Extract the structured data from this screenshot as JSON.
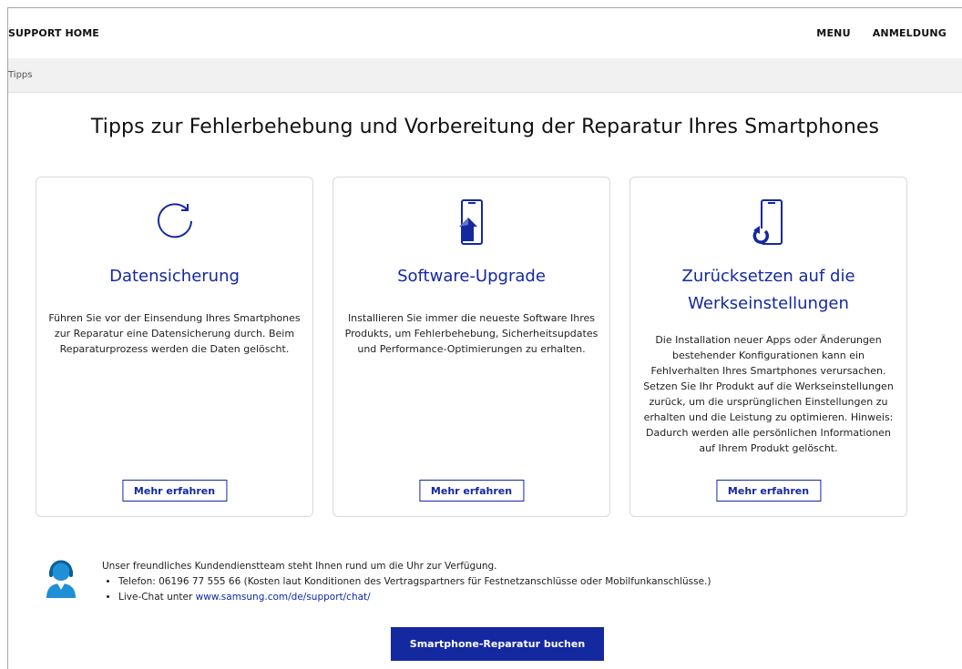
{
  "header": {
    "brand": "SUPPORT HOME",
    "menu": "MENU",
    "login": "ANMELDUNG"
  },
  "breadcrumb": "Tipps",
  "page_title": "Tipps zur Fehlerbehebung und Vorbereitung der Reparatur Ihres Smartphones",
  "cards": [
    {
      "icon": "refresh-icon",
      "title": "Datensicherung",
      "text": "Führen Sie vor der Einsendung Ihres Smartphones zur Reparatur eine Datensicherung durch. Beim Reparaturprozess werden die Daten gelöscht.",
      "button": "Mehr erfahren"
    },
    {
      "icon": "phone-upgrade-icon",
      "title": "Software-Upgrade",
      "text": "Installieren Sie immer die neueste Software Ihres Produkts, um Fehlerbehebung, Sicherheitsupdates und Performance-Optimierungen zu erhalten.",
      "button": "Mehr erfahren"
    },
    {
      "icon": "phone-reset-icon",
      "title": "Zurücksetzen auf die Werkseinstellungen",
      "text": "Die Installation neuer Apps oder Änderungen bestehender Konfigurationen kann ein Fehlverhalten Ihres Smartphones verursachen. Setzen Sie Ihr Produkt auf die Werkseinstellungen zurück, um die ursprünglichen Einstellungen zu erhalten und die Leistung zu optimieren. Hinweis: Dadurch werden alle persönlichen Informationen auf Ihrem Produkt gelöscht.",
      "button": "Mehr erfahren"
    }
  ],
  "support": {
    "intro": "Unser freundliches Kundendienstteam steht Ihnen rund um die Uhr zur Verfügung.",
    "phone": "Telefon: 06196 77 555 66 (Kosten laut Konditionen des Vertragspartners für Festnetzanschlüsse oder Mobilfunkanschlüsse.)",
    "chat_prefix": "Live-Chat unter",
    "chat_link": "www.samsung.com/de/support/chat/"
  },
  "cta": "Smartphone-Reparatur buchen",
  "colors": {
    "accent": "#1428a0",
    "breadcrumb_bg": "#f1f1f1",
    "avatar": "#1f8fd6"
  }
}
